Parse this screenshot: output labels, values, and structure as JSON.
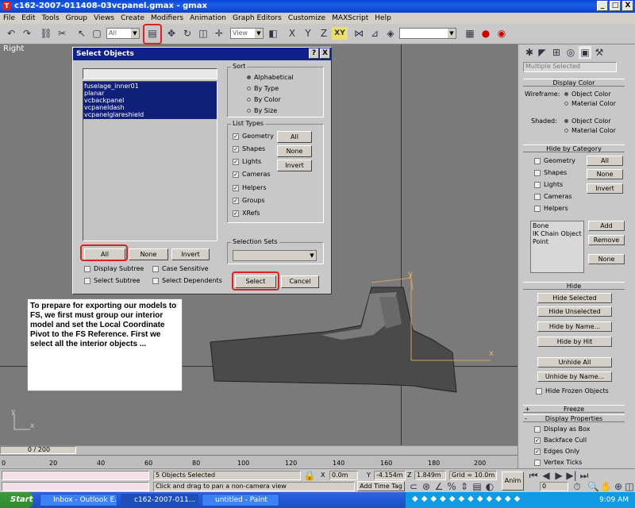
{
  "window": {
    "title": "c162-2007-011408-03vcpanel.gmax - gmax",
    "minimize": "_",
    "maximize": "□",
    "close": "X"
  },
  "menu": [
    "File",
    "Edit",
    "Tools",
    "Group",
    "Views",
    "Create",
    "Modifiers",
    "Animation",
    "Graph Editors",
    "Customize",
    "MAXScript",
    "Help"
  ],
  "toolbar": {
    "selection_filter": "All",
    "ref_coord": "View",
    "axis": "XY",
    "named_selection": ""
  },
  "viewport": {
    "label": "Right",
    "gizmo_y": "y",
    "gizmo_x": "x",
    "axis_y": "y",
    "axis_x": "x"
  },
  "dialog": {
    "title": "Select Objects",
    "help_btn": "?",
    "close_btn": "X",
    "objects": [
      "fuselage_inner01",
      "planar",
      "vcbackpanel",
      "vcpaneldash",
      "vcpanelglareshield"
    ],
    "btn_all": "All",
    "btn_none": "None",
    "btn_invert": "Invert",
    "display_subtree": "Display Subtree",
    "case_sensitive": "Case Sensitive",
    "select_subtree": "Select Subtree",
    "select_dependents": "Select Dependents",
    "sort": {
      "label": "Sort",
      "options": [
        "Alphabetical",
        "By Type",
        "By Color",
        "By Size"
      ]
    },
    "list_types": {
      "label": "List Types",
      "items": [
        "Geometry",
        "Shapes",
        "Lights",
        "Cameras",
        "Helpers",
        "Groups",
        "XRefs"
      ],
      "btn_all": "All",
      "btn_none": "None",
      "btn_invert": "Invert"
    },
    "selection_sets": {
      "label": "Selection Sets",
      "value": ""
    },
    "select_btn": "Select",
    "cancel_btn": "Cancel"
  },
  "note": "To prepare for exporting our models to FS, we first must group our interior model and set the Local Coordinate Pivot to the FS Reference.  First we select all the interior objects ...",
  "cmd_panel": {
    "name_field": "Multiple Selected",
    "display_color": {
      "title": "Display Color",
      "wireframe": "Wireframe:",
      "shaded": "Shaded:",
      "object_color": "Object Color",
      "material_color": "Material Color"
    },
    "hide_by_category": {
      "title": "Hide by Category",
      "items": [
        "Geometry",
        "Shapes",
        "Lights",
        "Cameras",
        "Helpers"
      ],
      "btn_all": "All",
      "btn_none": "None",
      "btn_invert": "Invert",
      "list": [
        "Bone",
        "IK Chain Object",
        "Point"
      ],
      "btn_add": "Add",
      "btn_remove": "Remove",
      "btn_none2": "None"
    },
    "hide": {
      "title": "Hide",
      "buttons": [
        "Hide Selected",
        "Hide Unselected",
        "Hide by Name...",
        "Hide by Hit",
        "Unhide All",
        "Unhide by Name..."
      ],
      "hide_frozen": "Hide Frozen Objects"
    },
    "freeze": {
      "sign": "+",
      "title": "Freeze"
    },
    "display_properties": {
      "sign": "-",
      "title": "Display Properties",
      "items": [
        "Display as Box",
        "Backface Cull",
        "Edges Only",
        "Vertex Ticks"
      ]
    }
  },
  "timeline": {
    "slider": "0 / 200",
    "ticks": [
      "0",
      "20",
      "40",
      "60",
      "80",
      "100",
      "120",
      "140",
      "160",
      "180",
      "200"
    ]
  },
  "status": {
    "objects_selected": "5 Objects Selected",
    "prompt": "Click and drag to pan a non-camera view",
    "x_label": "X",
    "x": "0.0m",
    "y_label": "Y",
    "y": "-4.154m",
    "z_label": "Z",
    "z": "1.849m",
    "grid": "Grid = 10.0m",
    "add_time_tag": "Add Time Tag",
    "anim": "Anim",
    "frame": "0"
  },
  "taskbar": {
    "start": "Start",
    "tasks": [
      "Inbox - Outlook E...",
      "c162-2007-011...",
      "untitled - Paint"
    ],
    "clock": "9:09 AM"
  }
}
